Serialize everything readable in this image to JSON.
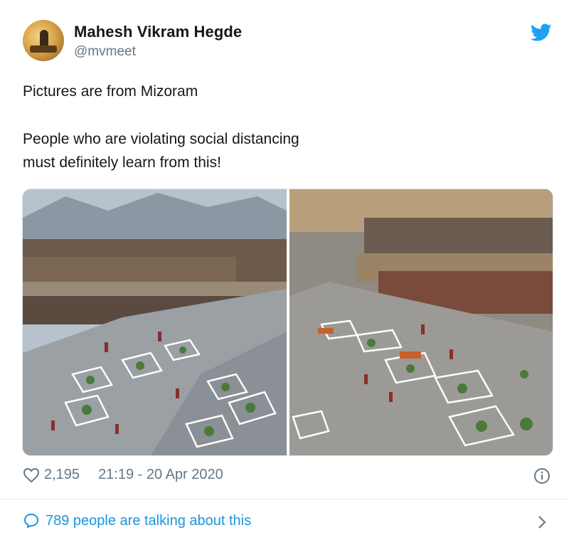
{
  "tweet": {
    "author_name": "Mahesh Vikram Hegde",
    "author_handle": "@mvmeet",
    "lines": [
      "Pictures are from Mizoram",
      "People who are violating social distancing",
      "must definitely learn from this!"
    ],
    "likes": "2,195",
    "timestamp": "21:19 - 20 Apr 2020",
    "talking": "789 people are talking about this"
  },
  "icons": {
    "brand": "twitter-bird-icon",
    "like": "heart-icon",
    "info": "info-icon",
    "reply": "speech-bubble-icon",
    "chevron": "chevron-right-icon"
  },
  "colors": {
    "accent": "#1da1f2",
    "link": "#1b95e0",
    "muted": "#657786"
  }
}
